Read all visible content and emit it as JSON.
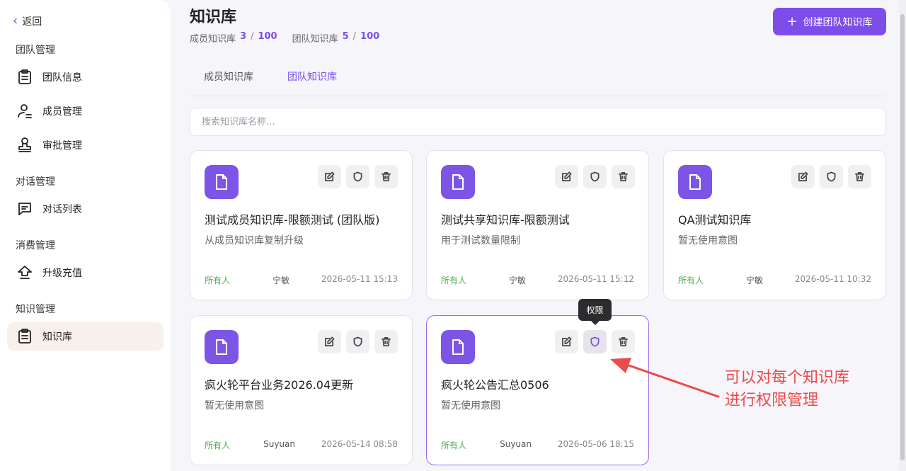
{
  "sidebar": {
    "back_label": "返回",
    "groups": [
      {
        "title": "团队管理",
        "items": [
          {
            "label": "团队信息",
            "icon": "clipboard-icon"
          },
          {
            "label": "成员管理",
            "icon": "user-icon"
          },
          {
            "label": "审批管理",
            "icon": "stamp-icon"
          }
        ]
      },
      {
        "title": "对话管理",
        "items": [
          {
            "label": "对话列表",
            "icon": "chat-icon"
          }
        ]
      },
      {
        "title": "消费管理",
        "items": [
          {
            "label": "升级充值",
            "icon": "upgrade-icon"
          }
        ]
      },
      {
        "title": "知识管理",
        "items": [
          {
            "label": "知识库",
            "icon": "clipboard-icon",
            "active": true
          }
        ]
      }
    ]
  },
  "header": {
    "title": "知识库",
    "member_quota_label": "成员知识库",
    "member_used": "3",
    "member_total": "100",
    "team_quota_label": "团队知识库",
    "team_used": "5",
    "team_total": "100",
    "slash": "/",
    "create_button": "创建团队知识库"
  },
  "tabs": [
    {
      "label": "成员知识库",
      "active": false
    },
    {
      "label": "团队知识库",
      "active": true
    }
  ],
  "search": {
    "placeholder": "搜索知识库名称...",
    "value": ""
  },
  "cards": [
    {
      "title": "测试成员知识库-限额测试 (团队版)",
      "desc": "从成员知识库复制升级",
      "owner": "所有人",
      "creator": "宁敏",
      "date": "2026-05-11 15:13"
    },
    {
      "title": "测试共享知识库-限额测试",
      "desc": "用于测试数量限制",
      "owner": "所有人",
      "creator": "宁敏",
      "date": "2026-05-11 15:12"
    },
    {
      "title": "QA测试知识库",
      "desc": "暂无使用意图",
      "owner": "所有人",
      "creator": "宁敏",
      "date": "2026-05-11 10:32"
    },
    {
      "title": "疯火轮平台业务2026.04更新",
      "desc": "暂无使用意图",
      "owner": "所有人",
      "creator": "Suyuan",
      "date": "2026-05-14 08:58"
    },
    {
      "title": "疯火轮公告汇总0506",
      "desc": "暂无使用意图",
      "owner": "所有人",
      "creator": "Suyuan",
      "date": "2026-05-06 18:15"
    }
  ],
  "tooltip": {
    "text": "权限"
  },
  "annotation": {
    "line1": "可以对每个知识库",
    "line2": "进行权限管理"
  },
  "colors": {
    "accent": "#7c4de8",
    "owner_green": "#4caf50",
    "annotation_red": "#ec4b4b"
  }
}
